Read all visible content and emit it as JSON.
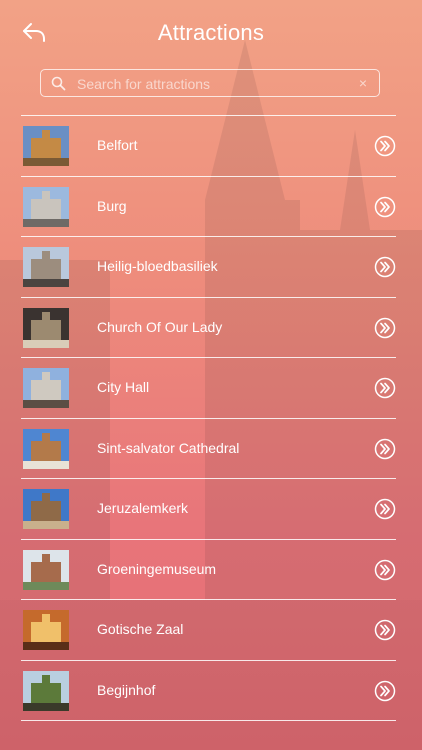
{
  "header": {
    "title": "Attractions"
  },
  "search": {
    "placeholder": "Search for attractions",
    "clear_icon": "×"
  },
  "items": [
    {
      "label": "Belfort",
      "icon": "belfort-thumbnail",
      "colors": [
        "#6a8fc4",
        "#c48a45",
        "#7a5a35"
      ]
    },
    {
      "label": "Burg",
      "icon": "burg-thumbnail",
      "colors": [
        "#9cb9de",
        "#c9c4bd",
        "#6e6a66"
      ]
    },
    {
      "label": "Heilig-bloedbasiliek",
      "icon": "basilica-thumbnail",
      "colors": [
        "#b9c8dc",
        "#9c8d7e",
        "#4a4440"
      ]
    },
    {
      "label": "Church Of Our Lady",
      "icon": "church-thumbnail",
      "colors": [
        "#3a3330",
        "#9c8a70",
        "#d9cdb8"
      ]
    },
    {
      "label": "City Hall",
      "icon": "city-hall-thumbnail",
      "colors": [
        "#8fb1de",
        "#cfc9c0",
        "#5a4e44"
      ]
    },
    {
      "label": "Sint-salvator Cathedral",
      "icon": "cathedral-thumbnail",
      "colors": [
        "#4f86d1",
        "#b37a4a",
        "#e8e2d6"
      ]
    },
    {
      "label": "Jeruzalemkerk",
      "icon": "jeruzalemkerk-thumbnail",
      "colors": [
        "#3f78c8",
        "#8f6a48",
        "#c9b08c"
      ]
    },
    {
      "label": "Groeningemuseum",
      "icon": "museum-thumbnail",
      "colors": [
        "#dde4ea",
        "#a66b4c",
        "#6e8a5a"
      ]
    },
    {
      "label": "Gotische Zaal",
      "icon": "gothic-hall-thumbnail",
      "colors": [
        "#c56a2c",
        "#f0c06a",
        "#5a2e18"
      ]
    },
    {
      "label": "Begijnhof",
      "icon": "begijnhof-thumbnail",
      "colors": [
        "#b9cfe0",
        "#5c7a3a",
        "#3a3a2a"
      ]
    }
  ]
}
